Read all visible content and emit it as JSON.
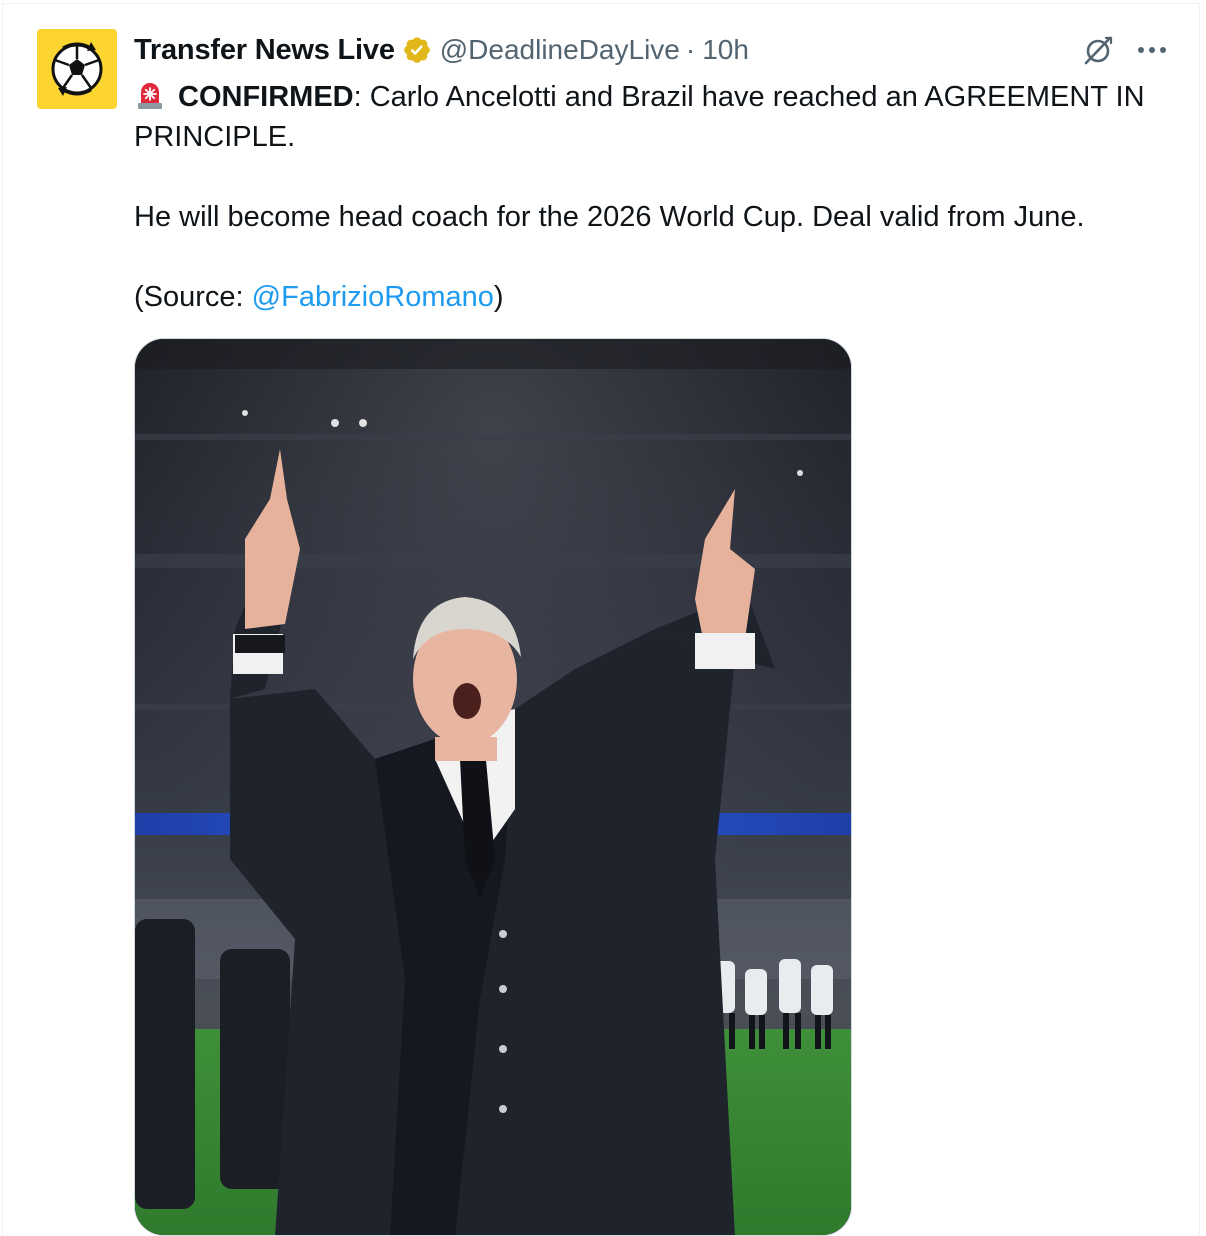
{
  "author": {
    "display_name": "Transfer News Live",
    "handle": "@DeadlineDayLive",
    "separator": "·",
    "timestamp": "10h",
    "verified": true,
    "verified_badge_color": "#e2b719",
    "avatar_bg": "#fcd531",
    "avatar_icon": "football-arrows-icon"
  },
  "tweet": {
    "siren_icon": "siren-emoji-icon",
    "confirmed_label": "CONFIRMED",
    "headline_rest": ": Carlo Ancelotti and Brazil have reached an AGREEMENT IN PRINCIPLE.",
    "body": "He will become head coach for the 2026 World Cup. Deal valid from June.",
    "source_prefix": "(Source: ",
    "source_mention": "@FabrizioRomano",
    "source_suffix": ")"
  },
  "actions": {
    "grok_icon": "grok-icon",
    "more_icon": "more-options-icon"
  },
  "media": {
    "kind": "photo",
    "subject": "celebrating-coach-photo"
  },
  "colors": {
    "text": "#0f1419",
    "secondary": "#536471",
    "link": "#1d9bf0",
    "border": "#cfd9de"
  }
}
